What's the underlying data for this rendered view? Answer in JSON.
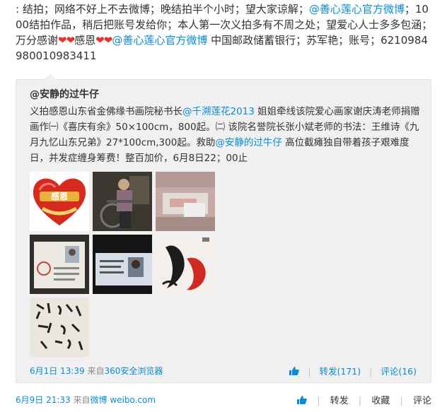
{
  "main": {
    "line1": ": 结拍；网络不好上不去微博；晚结拍半个小时；望大家谅解；",
    "mention1": "@善心莲心官方微博",
    "line1b": "；",
    "line2": "1000结拍作品，稍后把账号发给你；本人第一次义拍多有不周之处；望爱心人士多多包涵；万分感谢",
    "hearts1": "❤❤",
    "thanks": "感恩",
    "hearts2": "❤❤",
    "mention2": "@善心莲心官方微博",
    "line3": " 中国邮政储蓄银行；苏军艳；账号；6210984980010983411"
  },
  "repost": {
    "author": "@安静的过牛仔",
    "text_a": "义拍感恩山东省金佛缘书画院秘书长",
    "mention_a": "@千溯莲花2013",
    "text_b": " 姐姐牵线该院爱心画家谢庆涛老师捐赠画作㈠《喜庆有余》50×100cm，800起。㈡ 该院名誉院长张小斌老师的书法：王维诗《九月九忆山东兄弟》27*100cm,300起。救助",
    "mention_b": "@安静的过牛仔",
    "text_c": " 高位截瘫独自带着孩子艰难度日，并发症缠身筹费！整百加价，6月8日22；00止",
    "thumb1_caption": "感恩",
    "time": "6月1日 13:39",
    "from_label": "来自",
    "source": "360安全浏览器",
    "repost_label": "转发(171)",
    "comment_label": "评论(16)"
  },
  "footer": {
    "time": "6月9日 21:33",
    "from_label": "来自",
    "source": "微博 weibo.com",
    "repost_label": "转发",
    "favorite_label": "收藏",
    "comment_label": "评论"
  }
}
